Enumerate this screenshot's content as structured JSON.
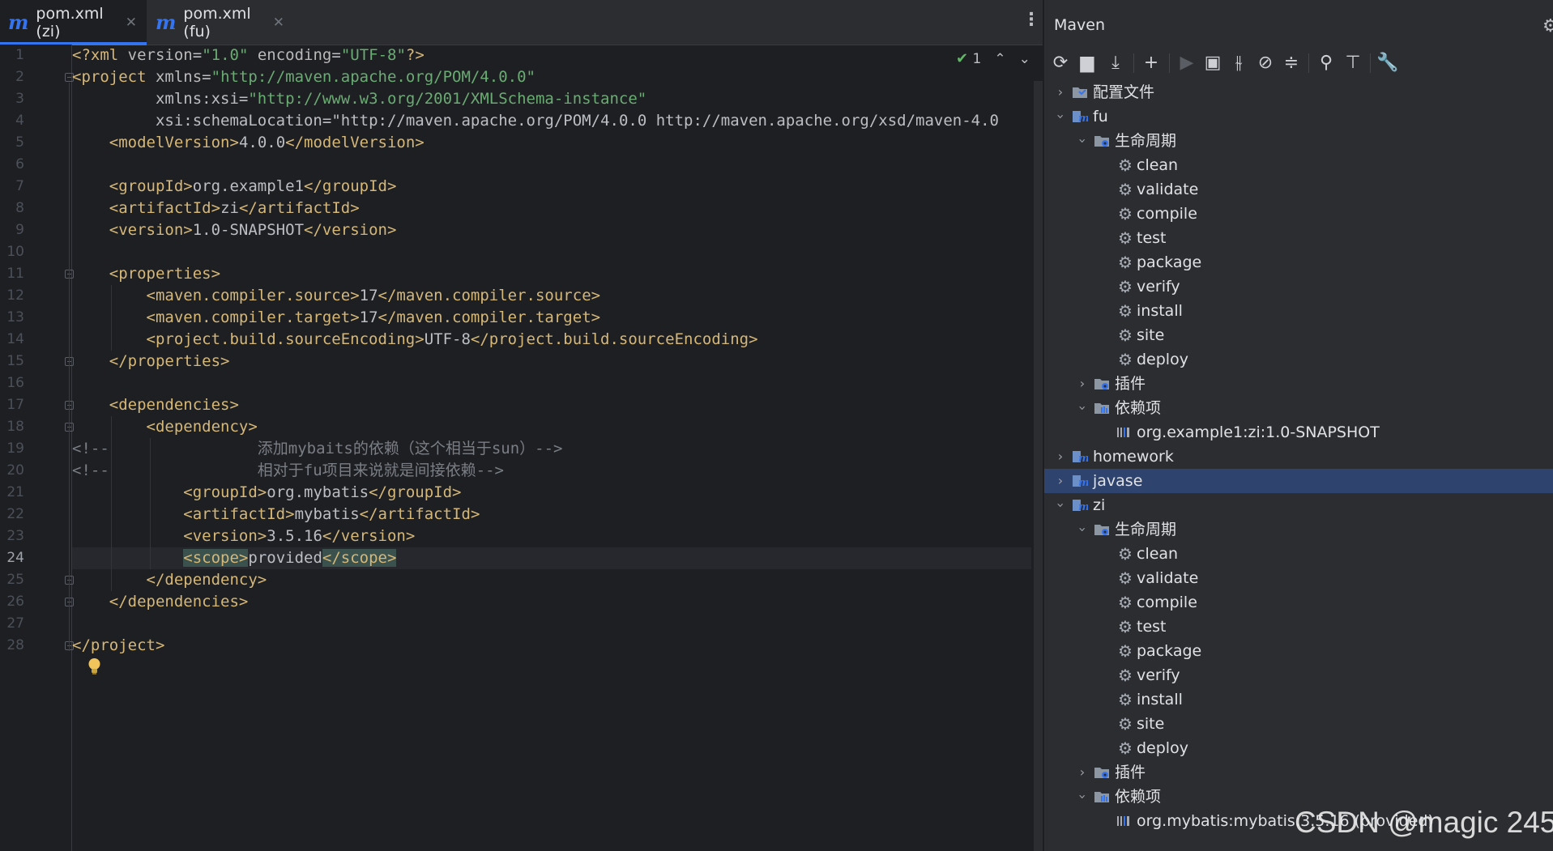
{
  "tabs": [
    {
      "label": "pom.xml (zi)",
      "active": true
    },
    {
      "label": "pom.xml (fu)",
      "active": false
    }
  ],
  "inspection": {
    "count": "1"
  },
  "code_lines": [
    {
      "num": "1",
      "text": "<?xml version=\"1.0\" encoding=\"UTF-8\"?>"
    },
    {
      "num": "2",
      "text": "<project xmlns=\"http://maven.apache.org/POM/4.0.0\""
    },
    {
      "num": "3",
      "text": "         xmlns:xsi=\"http://www.w3.org/2001/XMLSchema-instance\""
    },
    {
      "num": "4",
      "text": "         xsi:schemaLocation=\"http://maven.apache.org/POM/4.0.0 http://maven.apache.org/xsd/maven-4.0"
    },
    {
      "num": "5",
      "text": "    <modelVersion>4.0.0</modelVersion>"
    },
    {
      "num": "6",
      "text": ""
    },
    {
      "num": "7",
      "text": "    <groupId>org.example1</groupId>"
    },
    {
      "num": "8",
      "text": "    <artifactId>zi</artifactId>"
    },
    {
      "num": "9",
      "text": "    <version>1.0-SNAPSHOT</version>"
    },
    {
      "num": "10",
      "text": ""
    },
    {
      "num": "11",
      "text": "    <properties>"
    },
    {
      "num": "12",
      "text": "        <maven.compiler.source>17</maven.compiler.source>"
    },
    {
      "num": "13",
      "text": "        <maven.compiler.target>17</maven.compiler.target>"
    },
    {
      "num": "14",
      "text": "        <project.build.sourceEncoding>UTF-8</project.build.sourceEncoding>"
    },
    {
      "num": "15",
      "text": "    </properties>"
    },
    {
      "num": "16",
      "text": ""
    },
    {
      "num": "17",
      "text": "    <dependencies>"
    },
    {
      "num": "18",
      "text": "        <dependency>"
    },
    {
      "num": "19",
      "text": "<!--                添加mybaits的依赖（这个相当于sun）-->"
    },
    {
      "num": "20",
      "text": "<!--                相对于fu项目来说就是间接依赖-->"
    },
    {
      "num": "21",
      "text": "            <groupId>org.mybatis</groupId>"
    },
    {
      "num": "22",
      "text": "            <artifactId>mybatis</artifactId>"
    },
    {
      "num": "23",
      "text": "            <version>3.5.16</version>"
    },
    {
      "num": "24",
      "text": "            <scope>provided</scope>"
    },
    {
      "num": "25",
      "text": "        </dependency>"
    },
    {
      "num": "26",
      "text": "    </dependencies>"
    },
    {
      "num": "27",
      "text": ""
    },
    {
      "num": "28",
      "text": "</project>"
    }
  ],
  "maven": {
    "title": "Maven",
    "tree": {
      "profiles": "配置文件",
      "fu": "fu",
      "lifecycle": "生命周期",
      "phases": [
        "clean",
        "validate",
        "compile",
        "test",
        "package",
        "verify",
        "install",
        "site",
        "deploy"
      ],
      "plugins": "插件",
      "dependencies": "依赖项",
      "fu_dependency": "org.example1:zi:1.0-SNAPSHOT",
      "homework": "homework",
      "javase": "javase",
      "zi": "zi",
      "zi_dependency": "org.mybatis:mybatis:3.5.16 (provided)"
    }
  },
  "watermark": "CSDN @magic 245"
}
